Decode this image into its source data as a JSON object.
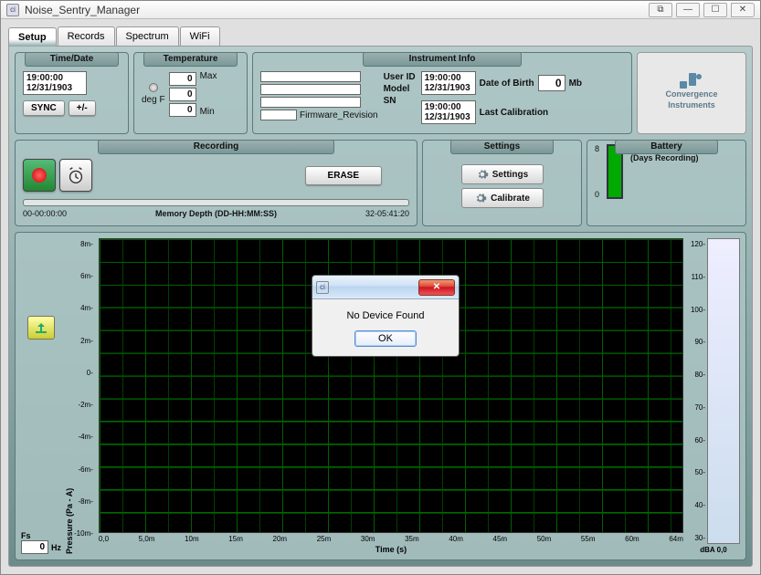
{
  "window": {
    "title": "Noise_Sentry_Manager"
  },
  "tabs": [
    "Setup",
    "Records",
    "Spectrum",
    "WiFi"
  ],
  "active_tab": "Setup",
  "time_date": {
    "header": "Time/Date",
    "time": "19:00:00",
    "date": "12/31/1903",
    "sync_btn": "SYNC",
    "plusminus_btn": "+/-"
  },
  "temperature": {
    "header": "Temperature",
    "max_label": "Max",
    "min_label": "Min",
    "max_val": "0",
    "cur_val": "0",
    "min_val": "0",
    "unit": "deg F"
  },
  "instrument": {
    "header": "Instrument Info",
    "user_id_label": "User ID",
    "model_label": "Model",
    "sn_label": "SN",
    "firmware_label": "Firmware_Revision",
    "user_id": "",
    "model": "",
    "sn": "",
    "firmware": "",
    "time": "19:00:00",
    "date": "12/31/1903",
    "dob_label": "Date of Birth",
    "mb_val": "0",
    "mb_label": "Mb",
    "cal_time": "19:00:00",
    "cal_date": "12/31/1903",
    "cal_label": "Last Calibration"
  },
  "brand": {
    "line1": "Convergence",
    "line2": "Instruments"
  },
  "recording": {
    "header": "Recording",
    "erase_btn": "ERASE",
    "left_val": "00-00:00:00",
    "caption": "Memory Depth (DD-HH:MM:SS)",
    "right_val": "32-05:41:20"
  },
  "settings": {
    "header": "Settings",
    "settings_btn": "Settings",
    "calibrate_btn": "Calibrate"
  },
  "battery": {
    "header": "Battery",
    "max": "8",
    "min": "0",
    "label": "Battery",
    "sublabel": "(Days Recording)"
  },
  "fs": {
    "label": "Fs",
    "value": "0",
    "unit": "Hz"
  },
  "dba": {
    "label": "dBA",
    "value": "0,0"
  },
  "dialog": {
    "message": "No Device Found",
    "ok": "OK"
  },
  "chart_data": {
    "type": "line",
    "title": "",
    "xlabel": "Time (s)",
    "ylabel": "Pressure (Pa - A)",
    "x_ticks": [
      "0,0",
      "5,0m",
      "10m",
      "15m",
      "20m",
      "25m",
      "30m",
      "35m",
      "40m",
      "45m",
      "50m",
      "55m",
      "60m",
      "64m"
    ],
    "y_ticks": [
      "8m",
      "6m",
      "4m",
      "2m",
      "0",
      "-2m",
      "-4m",
      "-6m",
      "-8m",
      "-10m"
    ],
    "xlim": [
      0,
      0.064
    ],
    "ylim": [
      -0.01,
      0.008
    ],
    "series": [],
    "secondary_axis": {
      "label": "dBA",
      "ticks": [
        "120",
        "110",
        "100",
        "90",
        "80",
        "70",
        "60",
        "50",
        "40",
        "30"
      ],
      "ylim": [
        30,
        120
      ],
      "value": 0.0
    }
  }
}
